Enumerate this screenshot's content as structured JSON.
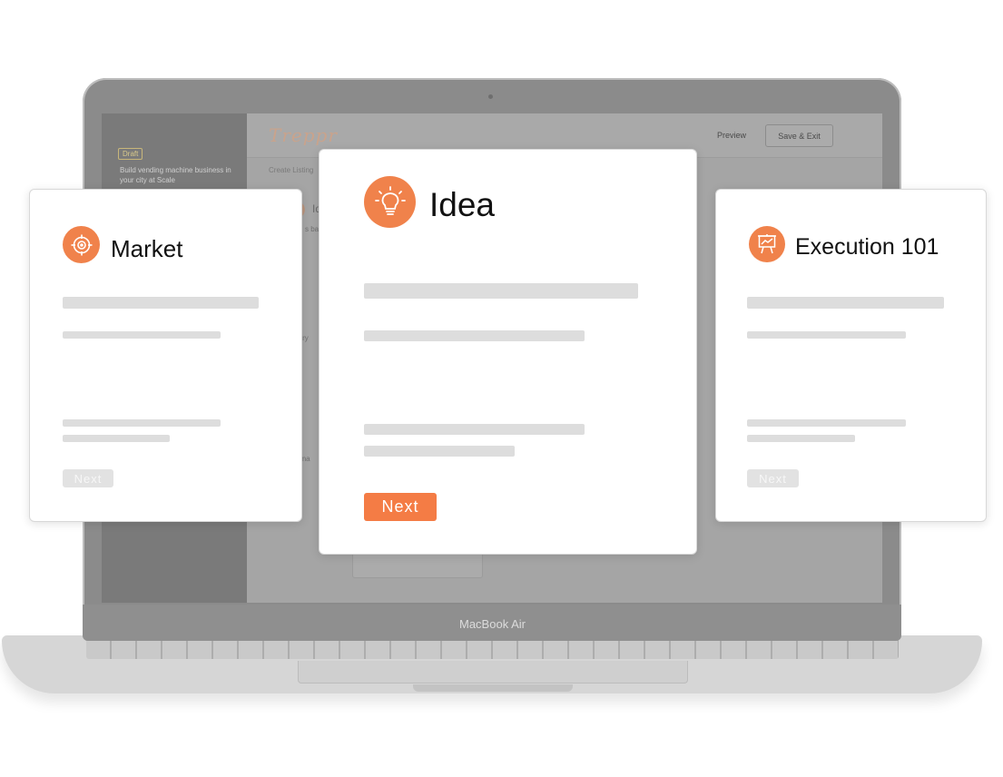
{
  "device": {
    "brand_label": "MacBook Air"
  },
  "app": {
    "logo_text": "Treppr",
    "header": {
      "preview_label": "Preview",
      "save_exit_label": "Save & Exit"
    },
    "sidebar": {
      "status_badge": "Draft",
      "listing_title": "Build vending machine business in your city at Scale"
    },
    "breadcrumb": "Create Listing",
    "form_fragments": {
      "section_title": "Id",
      "section_sub": "s basi",
      "title_label": "le",
      "summary_label": "mary",
      "image_label": "a ima"
    }
  },
  "cards": [
    {
      "id": "market",
      "title": "Market",
      "icon": "target-icon",
      "button_label": "Next",
      "state": "disabled"
    },
    {
      "id": "idea",
      "title": "Idea",
      "icon": "lightbulb-icon",
      "button_label": "Next",
      "state": "active"
    },
    {
      "id": "execution",
      "title": "Execution 101",
      "icon": "presentation-chart-icon",
      "button_label": "Next",
      "state": "disabled"
    }
  ],
  "colors": {
    "accent": "#f47c45",
    "icon_bg": "#f0824b",
    "placeholder_bar": "#dddddd",
    "laptop_screen": "#9a9a9a"
  }
}
